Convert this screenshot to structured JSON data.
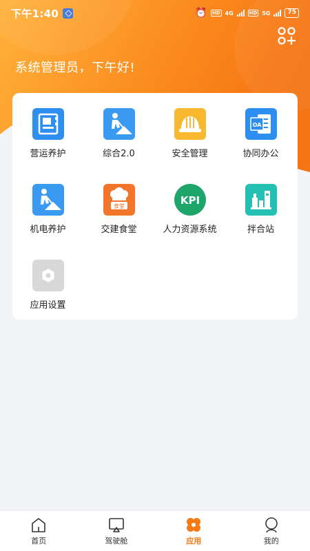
{
  "status_bar": {
    "time": "下午1:40",
    "net_tag_1": "HD",
    "net_gen_1": "4G",
    "net_tag_2": "HD",
    "net_gen_2": "5G",
    "battery": "75"
  },
  "header": {
    "greeting": "系统管理员，下午好!",
    "action_icon": "add-app-icon"
  },
  "apps": [
    {
      "label": "营运养护",
      "icon": "ledger-icon",
      "color": "#2f8ff0"
    },
    {
      "label": "综合2.0",
      "icon": "worker-digging-icon",
      "color": "#3a9af2"
    },
    {
      "label": "安全管理",
      "icon": "hard-hat-icon",
      "color": "#f8b830"
    },
    {
      "label": "协同办公",
      "icon": "oa-office-icon",
      "color": "#2e8ef0"
    },
    {
      "label": "机电养护",
      "icon": "worker-digging-icon",
      "color": "#3a9af2"
    },
    {
      "label": "交建食堂",
      "icon": "canteen-chef-hat-icon",
      "color": "#f2752a"
    },
    {
      "label": "人力资源系统",
      "icon": "kpi-icon",
      "color": "#1da56a"
    },
    {
      "label": "拌合站",
      "icon": "mixing-plant-icon",
      "color": "#25c0b4"
    },
    {
      "label": "应用设置",
      "icon": "settings-hexagon-icon",
      "color": "#d8d8d8"
    }
  ],
  "canteen_badge": "食堂",
  "kpi_text": "KPI",
  "oa_text": "OA",
  "tabbar": {
    "items": [
      {
        "label": "首页",
        "icon": "home-icon",
        "active": false
      },
      {
        "label": "驾驶舱",
        "icon": "cockpit-screen-icon",
        "active": false
      },
      {
        "label": "应用",
        "icon": "apps-flower-icon",
        "active": true
      },
      {
        "label": "我的",
        "icon": "profile-icon",
        "active": false
      }
    ]
  },
  "colors": {
    "brand_orange": "#f47a16",
    "background": "#f3f4f8"
  }
}
